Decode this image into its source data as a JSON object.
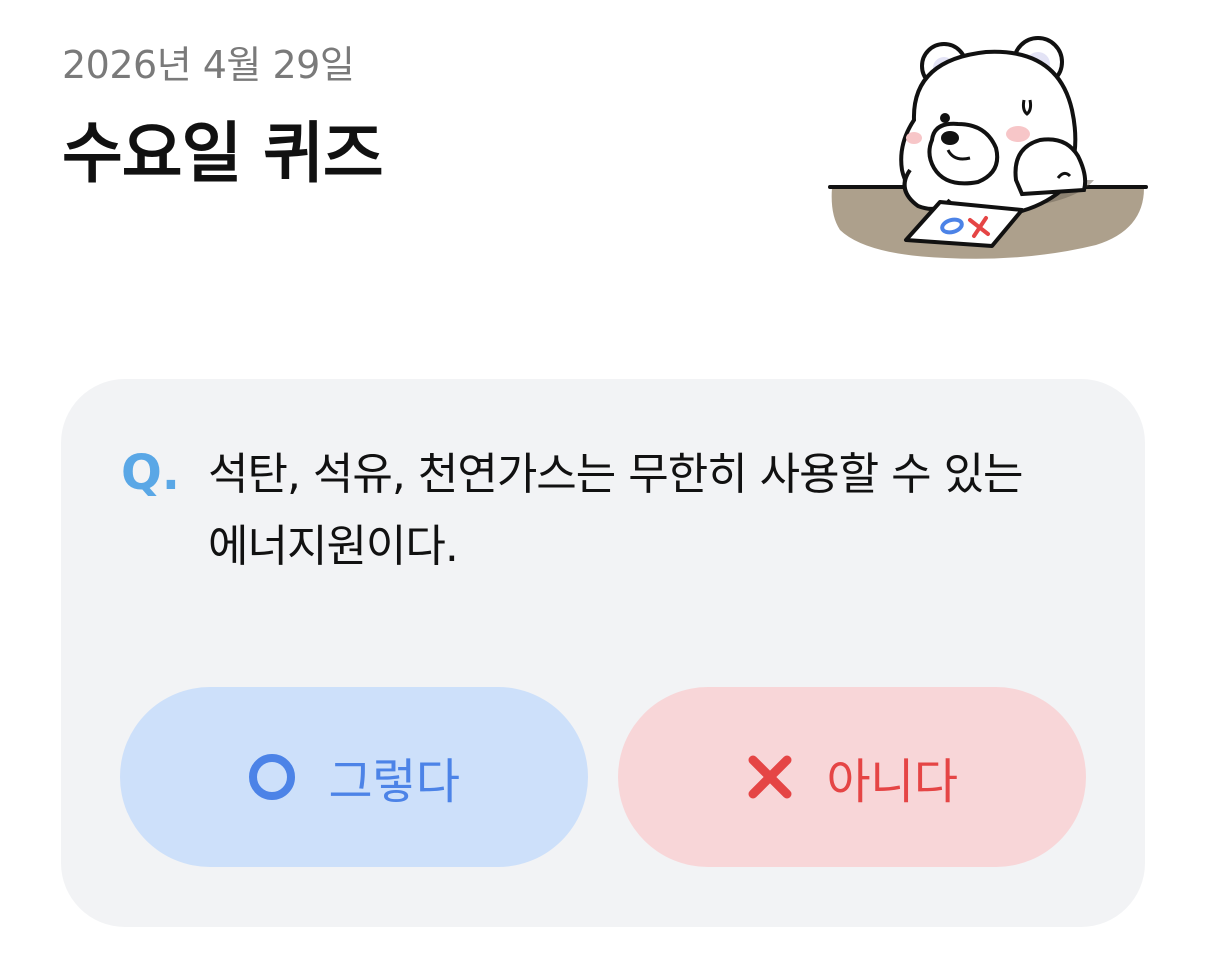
{
  "header": {
    "date": "2026년 4월 29일",
    "title": "수요일 퀴즈"
  },
  "mascot": {
    "icon": "polar-bear-mascot-icon",
    "paper_text": "OX"
  },
  "quiz": {
    "q_mark": "Q.",
    "question_line1": "석탄, 석유, 천연가스는 무한히 사용할 수 있는",
    "question_line2": "에너지원이다.",
    "yes_label": "그렇다",
    "no_label": "아니다",
    "yes_icon": "circle-o-icon",
    "no_icon": "cross-x-icon"
  },
  "colors": {
    "q_mark": "#5aa7e6",
    "yes_bg": "#cde0fa",
    "yes_fg": "#4c83e7",
    "no_bg": "#f8d6d8",
    "no_fg": "#e54545",
    "card_bg": "#f2f3f5"
  }
}
